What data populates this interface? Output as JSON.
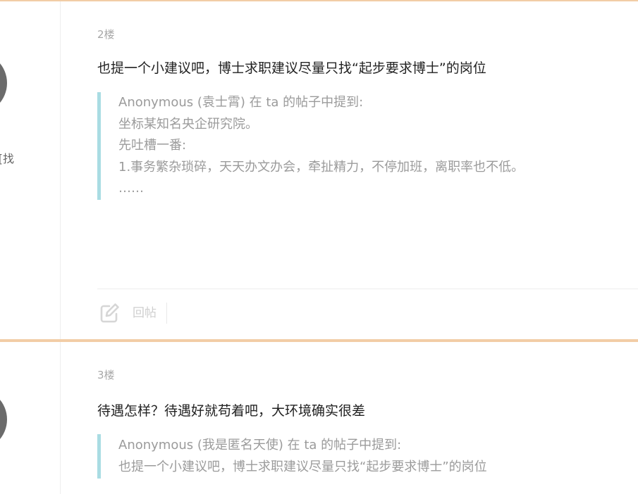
{
  "posts": [
    {
      "side_text": "找]",
      "floor": "2楼",
      "content": "也提一个小建议吧，博士求职建议尽量只找“起步要求博士”的岗位",
      "quote": {
        "lines": [
          "Anonymous (袁士霄) 在 ta 的帖子中提到:",
          "坐标某知名央企研究院。",
          "先吐槽一番:",
          "1.事务繁杂琐碎，天天办文办会，牵扯精力，不停加班，离职率也不低。",
          "……"
        ]
      },
      "actions": {
        "reply_label": "回帖",
        "reply_icon": "edit-icon"
      }
    },
    {
      "floor": "3楼",
      "content": "待遇怎样？待遇好就苟着吧，大环境确实很差",
      "quote": {
        "lines": [
          "Anonymous (我是匿名天使) 在 ta 的帖子中提到:",
          "也提一个小建议吧，博士求职建议尽量只找“起步要求博士”的岗位"
        ]
      }
    }
  ],
  "colors": {
    "divider_accent": "#f2cda6",
    "quote_bar": "#a9dce3",
    "avatar": "#6b6b6b"
  }
}
